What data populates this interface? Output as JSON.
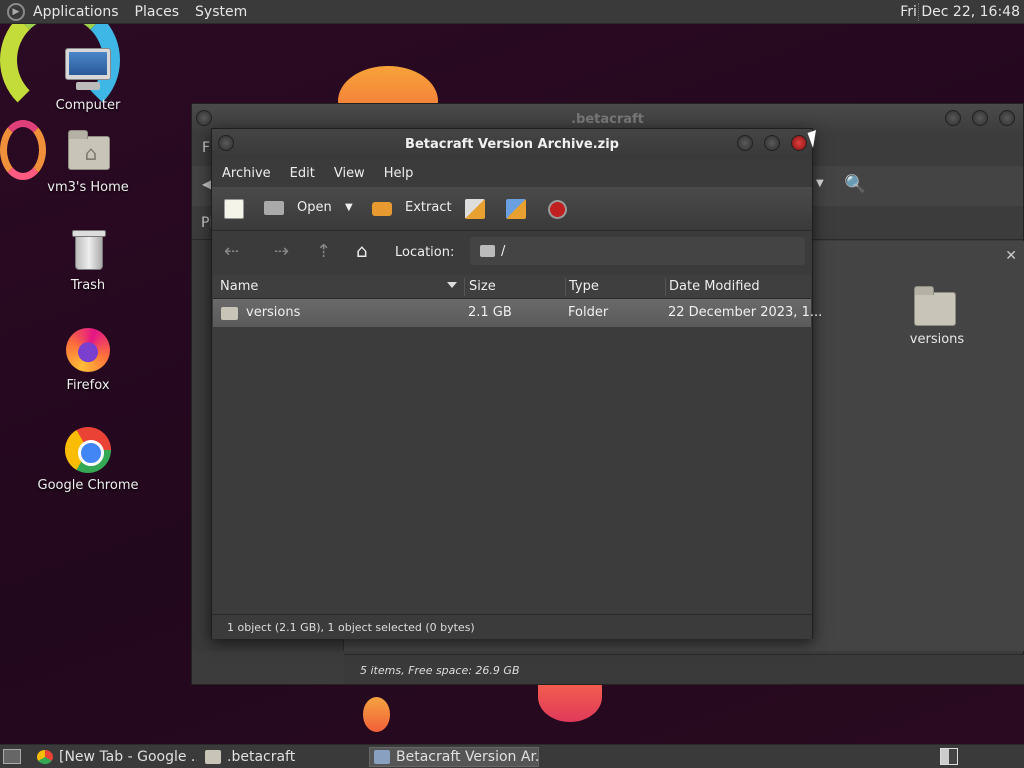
{
  "top_panel": {
    "menus": [
      "Applications",
      "Places",
      "System"
    ],
    "clock": "Fri Dec 22, 16:48"
  },
  "desktop_icons": [
    {
      "label": "Computer",
      "icon": "computer-icon"
    },
    {
      "label": "vm3's Home",
      "icon": "home-folder-icon"
    },
    {
      "label": "Trash",
      "icon": "trash-icon"
    },
    {
      "label": "Firefox",
      "icon": "firefox-icon"
    },
    {
      "label": "Google Chrome",
      "icon": "chrome-icon"
    }
  ],
  "file_manager": {
    "title": ".betacraft",
    "folder_item": "versions",
    "status": "5 items, Free space: 26.9 GB"
  },
  "archive_manager": {
    "title": "Betacraft Version Archive.zip",
    "menus": [
      "Archive",
      "Edit",
      "View",
      "Help"
    ],
    "toolbar": {
      "open": "Open",
      "extract": "Extract"
    },
    "location_label": "Location:",
    "location_path": "/",
    "columns": [
      "Name",
      "Size",
      "Type",
      "Date Modified"
    ],
    "rows": [
      {
        "name": "versions",
        "size": "2.1 GB",
        "type": "Folder",
        "date": "22 December 2023, 1..."
      }
    ],
    "status": "1 object (2.1 GB), 1 object selected (0 bytes)"
  },
  "taskbar": {
    "tasks": [
      "[New Tab - Google ...",
      ".betacraft",
      "Betacraft Version Ar..."
    ]
  },
  "colors": {
    "wallpaper": "#2a0b22",
    "panel": "#3a3a3a",
    "close_button": "#e04040"
  }
}
